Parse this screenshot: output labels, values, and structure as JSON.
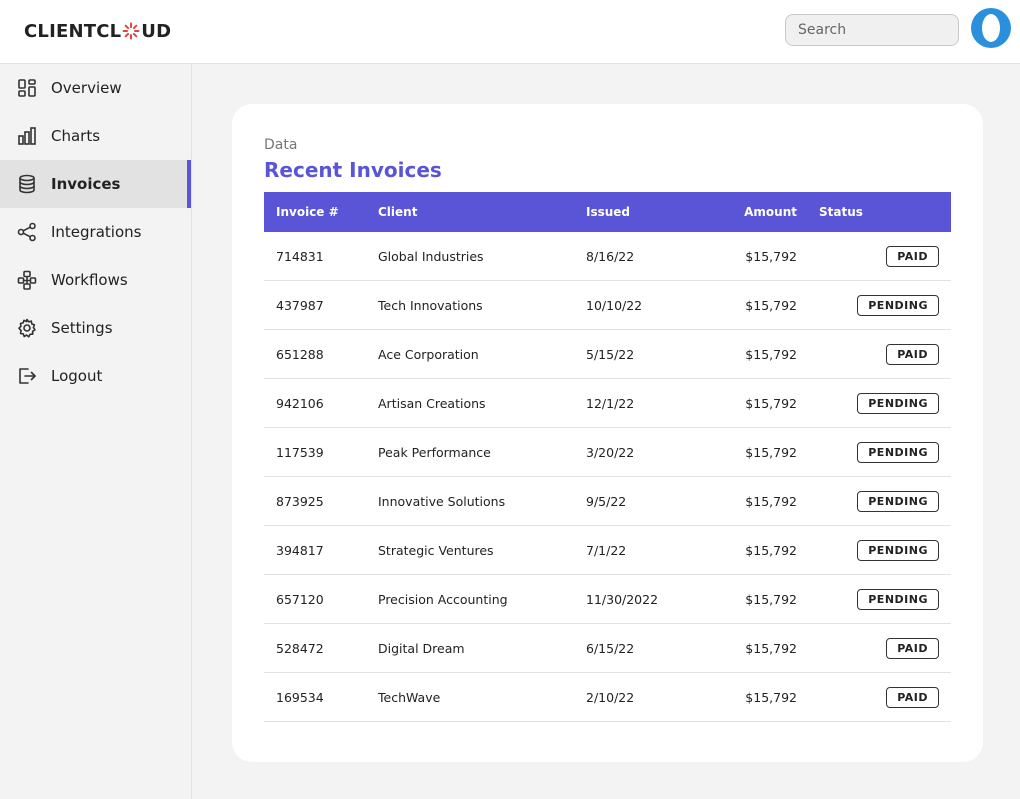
{
  "brand": {
    "logo_text_left": "CLIENTCL",
    "logo_text_right": "UD",
    "logo_mark": "asterisk-o-icon"
  },
  "search": {
    "placeholder": "Search"
  },
  "sidebar": {
    "items": [
      {
        "label": "Overview",
        "icon": "dashboard-grid-icon"
      },
      {
        "label": "Charts",
        "icon": "bar-chart-icon"
      },
      {
        "label": "Invoices",
        "icon": "database-icon",
        "active": true
      },
      {
        "label": "Integrations",
        "icon": "share-nodes-icon"
      },
      {
        "label": "Workflows",
        "icon": "workflow-icon"
      },
      {
        "label": "Settings",
        "icon": "gear-icon"
      },
      {
        "label": "Logout",
        "icon": "logout-icon"
      }
    ]
  },
  "card": {
    "eyebrow": "Data",
    "title": "Recent Invoices",
    "columns": {
      "invoice": "Invoice #",
      "client": "Client",
      "issued": "Issued",
      "amount": "Amount",
      "status": "Status"
    },
    "rows": [
      {
        "invoice": "714831",
        "client": "Global Industries",
        "issued": "8/16/22",
        "amount": "$15,792",
        "status": "PAID"
      },
      {
        "invoice": "437987",
        "client": "Tech Innovations",
        "issued": "10/10/22",
        "amount": "$15,792",
        "status": "PENDING"
      },
      {
        "invoice": "651288",
        "client": "Ace Corporation",
        "issued": "5/15/22",
        "amount": "$15,792",
        "status": "PAID"
      },
      {
        "invoice": "942106",
        "client": "Artisan Creations",
        "issued": "12/1/22",
        "amount": "$15,792",
        "status": "PENDING"
      },
      {
        "invoice": "117539",
        "client": "Peak Performance",
        "issued": "3/20/22",
        "amount": "$15,792",
        "status": "PENDING"
      },
      {
        "invoice": "873925",
        "client": "Innovative Solutions",
        "issued": "9/5/22",
        "amount": "$15,792",
        "status": "PENDING"
      },
      {
        "invoice": "394817",
        "client": "Strategic Ventures",
        "issued": "7/1/22",
        "amount": "$15,792",
        "status": "PENDING"
      },
      {
        "invoice": "657120",
        "client": "Precision Accounting",
        "issued": "11/30/2022",
        "amount": "$15,792",
        "status": "PENDING"
      },
      {
        "invoice": "528472",
        "client": "Digital Dream",
        "issued": "6/15/22",
        "amount": "$15,792",
        "status": "PAID"
      },
      {
        "invoice": "169534",
        "client": "TechWave",
        "issued": "2/10/22",
        "amount": "$15,792",
        "status": "PAID"
      }
    ]
  },
  "colors": {
    "accent": "#5a55d6",
    "logo_mark": "#e0443c",
    "avatar": "#2a8fdc"
  }
}
